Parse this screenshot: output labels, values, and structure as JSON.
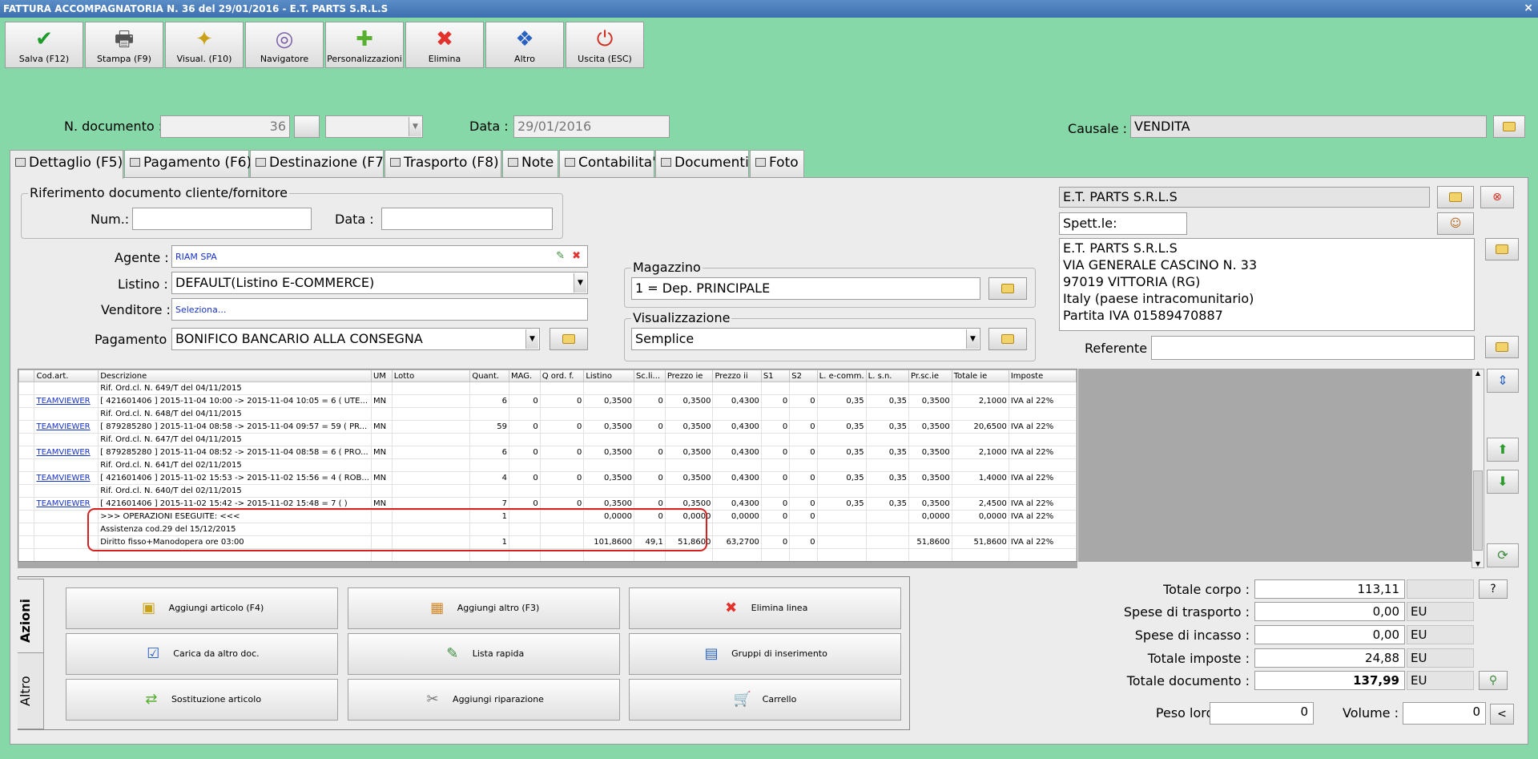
{
  "window": {
    "title": "FATTURA ACCOMPAGNATORIA N. 36 del 29/01/2016 - E.T. PARTS S.R.L.S",
    "close": "×"
  },
  "toolbar": [
    {
      "label": "Salva (F12)",
      "icon": "✔",
      "color": "#1e9b2b"
    },
    {
      "label": "Stampa (F9)",
      "icon": "🖶",
      "color": "#555555"
    },
    {
      "label": "Visual. (F10)",
      "icon": "✦",
      "color": "#c9a21a"
    },
    {
      "label": "Navigatore",
      "icon": "◎",
      "color": "#7a5ca8"
    },
    {
      "label": "Personalizzazioni",
      "icon": "✚",
      "color": "#58b030"
    },
    {
      "label": "Elimina",
      "icon": "✖",
      "color": "#e2322b"
    },
    {
      "label": "Altro",
      "icon": "❖",
      "color": "#2a62c4"
    },
    {
      "label": "Uscita (ESC)",
      "icon": "⏻",
      "color": "#d12d20"
    }
  ],
  "header": {
    "ndoc_label": "N. documento :",
    "ndoc_value": "36",
    "data_label": "Data :",
    "data_value": "29/01/2016",
    "causale_label": "Causale :",
    "causale_value": "VENDITA"
  },
  "tabs": [
    "Dettaglio (F5)",
    "Pagamento (F6)",
    "Destinazione (F7)",
    "Trasporto (F8)",
    "Note",
    "Contabilita'",
    "Documenti",
    "Foto"
  ],
  "riferimento": {
    "title": "Riferimento documento cliente/fornitore",
    "num_label": "Num.:",
    "data_label": "Data :"
  },
  "form": {
    "agente_label": "Agente :",
    "agente_value": "RIAM SPA",
    "listino_label": "Listino :",
    "listino_value": "DEFAULT(Listino E-COMMERCE)",
    "venditore_label": "Venditore :",
    "venditore_value": "Seleziona...",
    "pagamento_label": "Pagamento :",
    "pagamento_value": "BONIFICO BANCARIO ALLA CONSEGNA",
    "magazzino_title": "Magazzino",
    "magazzino_value": "1 = Dep. PRINCIPALE",
    "visual_title": "Visualizzazione",
    "visual_value": "Semplice"
  },
  "cliente": {
    "name": "E.T. PARTS S.R.L.S",
    "spett": "Spett.le:",
    "address": [
      "E.T. PARTS S.R.L.S",
      "VIA GENERALE CASCINO N. 33",
      "97019 VITTORIA (RG)",
      "Italy (paese intracomunitario)",
      "Partita IVA 01589470887"
    ],
    "referente_label": "Referente"
  },
  "grid": {
    "columns": [
      "Cod.art.",
      "Descrizione",
      "UM",
      "Lotto",
      "Quant.",
      "MAG.",
      "Q ord. f.",
      "Listino",
      "Sc.li...",
      "Prezzo ie",
      "Prezzo ii",
      "S1",
      "S2",
      "L. e-comm.",
      "L. s.n.",
      "Pr.sc.ie",
      "Totale ie",
      "Imposte"
    ],
    "rows": [
      [
        "",
        "Rif. Ord.cl. N. 649/T del 04/11/2015",
        "",
        "",
        "",
        "",
        "",
        "",
        "",
        "",
        "",
        "",
        "",
        "",
        "",
        "",
        "",
        ""
      ],
      [
        "TEAMVIEWER",
        "[ 421601406 ] 2015-11-04 10:00 -> 2015-11-04 10:05 = 6 ( UTE...",
        "MN",
        "",
        "6",
        "0",
        "0",
        "0,3500",
        "0",
        "0,3500",
        "0,4300",
        "0",
        "0",
        "0,35",
        "0,35",
        "0,3500",
        "2,1000",
        "IVA al 22%"
      ],
      [
        "",
        "Rif. Ord.cl. N. 648/T del 04/11/2015",
        "",
        "",
        "",
        "",
        "",
        "",
        "",
        "",
        "",
        "",
        "",
        "",
        "",
        "",
        "",
        ""
      ],
      [
        "TEAMVIEWER",
        "[ 879285280 ] 2015-11-04 08:58 -> 2015-11-04 09:57 = 59 ( PR...",
        "MN",
        "",
        "59",
        "0",
        "0",
        "0,3500",
        "0",
        "0,3500",
        "0,4300",
        "0",
        "0",
        "0,35",
        "0,35",
        "0,3500",
        "20,6500",
        "IVA al 22%"
      ],
      [
        "",
        "Rif. Ord.cl. N. 647/T del 04/11/2015",
        "",
        "",
        "",
        "",
        "",
        "",
        "",
        "",
        "",
        "",
        "",
        "",
        "",
        "",
        "",
        ""
      ],
      [
        "TEAMVIEWER",
        "[ 879285280 ] 2015-11-04 08:52 -> 2015-11-04 08:58 = 6 ( PRO...",
        "MN",
        "",
        "6",
        "0",
        "0",
        "0,3500",
        "0",
        "0,3500",
        "0,4300",
        "0",
        "0",
        "0,35",
        "0,35",
        "0,3500",
        "2,1000",
        "IVA al 22%"
      ],
      [
        "",
        "Rif. Ord.cl. N. 641/T del 02/11/2015",
        "",
        "",
        "",
        "",
        "",
        "",
        "",
        "",
        "",
        "",
        "",
        "",
        "",
        "",
        "",
        ""
      ],
      [
        "TEAMVIEWER",
        "[ 421601406 ] 2015-11-02 15:53 -> 2015-11-02 15:56 = 4 ( ROB...",
        "MN",
        "",
        "4",
        "0",
        "0",
        "0,3500",
        "0",
        "0,3500",
        "0,4300",
        "0",
        "0",
        "0,35",
        "0,35",
        "0,3500",
        "1,4000",
        "IVA al 22%"
      ],
      [
        "",
        "Rif. Ord.cl. N. 640/T del 02/11/2015",
        "",
        "",
        "",
        "",
        "",
        "",
        "",
        "",
        "",
        "",
        "",
        "",
        "",
        "",
        "",
        ""
      ],
      [
        "TEAMVIEWER",
        "[ 421601406 ] 2015-11-02 15:42 -> 2015-11-02 15:48 = 7 ( )",
        "MN",
        "",
        "7",
        "0",
        "0",
        "0,3500",
        "0",
        "0,3500",
        "0,4300",
        "0",
        "0",
        "0,35",
        "0,35",
        "0,3500",
        "2,4500",
        "IVA al 22%"
      ],
      [
        "",
        ">>> OPERAZIONI ESEGUITE: <<<",
        "",
        "",
        "1",
        "",
        "",
        "0,0000",
        "0",
        "0,0000",
        "0,0000",
        "0",
        "0",
        "",
        "",
        "0,0000",
        "0,0000",
        "IVA al 22%"
      ],
      [
        "",
        "Assistenza cod.29 del 15/12/2015",
        "",
        "",
        "",
        "",
        "",
        "",
        "",
        "",
        "",
        "",
        "",
        "",
        "",
        "",
        "",
        ""
      ],
      [
        "",
        "Diritto fisso+Manodopera ore 03:00",
        "",
        "",
        "1",
        "",
        "",
        "101,8600",
        "49,1",
        "51,8600",
        "63,2700",
        "0",
        "0",
        "",
        "",
        "51,8600",
        "51,8600",
        "IVA al 22%"
      ],
      [
        "",
        "",
        "",
        "",
        "",
        "",
        "",
        "",
        "",
        "",
        "",
        "",
        "",
        "",
        "",
        "",
        "",
        ""
      ]
    ]
  },
  "actions": {
    "tab_azioni": "Azioni",
    "tab_altro": "Altro",
    "buttons": [
      {
        "label": "Aggiungi articolo (F4)",
        "icon": "▣",
        "color": "#c9a21a"
      },
      {
        "label": "Aggiungi altro (F3)",
        "icon": "▦",
        "color": "#d2872a"
      },
      {
        "label": "Elimina linea",
        "icon": "✖",
        "color": "#e2322b"
      },
      {
        "label": "Carica da altro doc.",
        "icon": "☑",
        "color": "#2a62c4"
      },
      {
        "label": "Lista rapida",
        "icon": "✎",
        "color": "#3a8a3a"
      },
      {
        "label": "Gruppi di inserimento",
        "icon": "▤",
        "color": "#2a62c4"
      },
      {
        "label": "Sostituzione articolo",
        "icon": "⇄",
        "color": "#58b030"
      },
      {
        "label": "Aggiungi riparazione",
        "icon": "✂",
        "color": "#777777"
      },
      {
        "label": "Carrello",
        "icon": "🛒",
        "color": "#555555"
      }
    ]
  },
  "totals": {
    "corpo_label": "Totale corpo :",
    "corpo_value": "113,11",
    "corpo_q": "?",
    "trasporto_label": "Spese di trasporto :",
    "trasporto_value": "0,00",
    "incasso_label": "Spese di incasso :",
    "incasso_value": "0,00",
    "imposte_label": "Totale imposte :",
    "imposte_value": "24,88",
    "documento_label": "Totale documento :",
    "documento_value": "137,99",
    "currency": "EU",
    "peso_label": "Peso lordo :",
    "peso_value": "0",
    "volume_label": "Volume :",
    "volume_value": "0",
    "volume_btn": "<"
  }
}
